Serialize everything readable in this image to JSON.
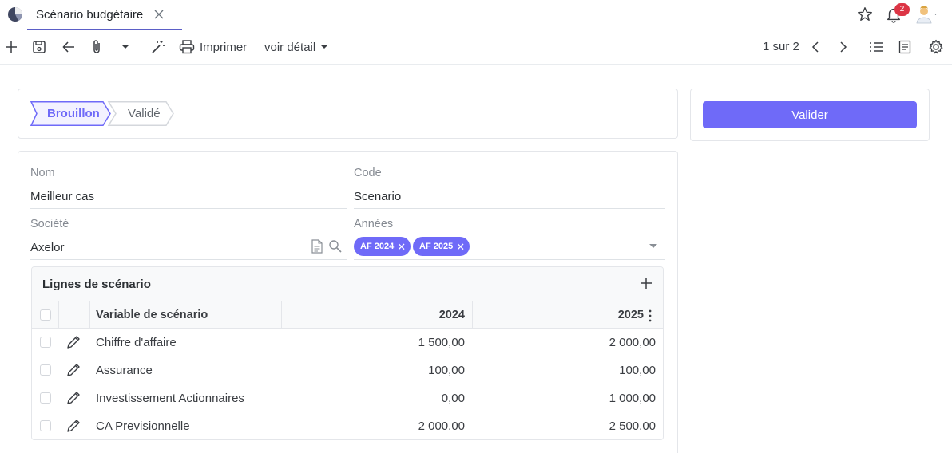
{
  "tabbar": {
    "tab_title": "Scénario budgétaire",
    "notification_count": "2"
  },
  "toolbar": {
    "print_label": "Imprimer",
    "detail_label": "voir détail",
    "pager_text": "1 sur 2"
  },
  "status": {
    "steps": [
      "Brouillon",
      "Validé"
    ],
    "active_step": "Brouillon"
  },
  "side": {
    "validate_label": "Valider"
  },
  "form": {
    "name_label": "Nom",
    "name_value": "Meilleur cas",
    "code_label": "Code",
    "code_value": "Scenario",
    "company_label": "Société",
    "company_value": "Axelor",
    "years_label": "Années",
    "years": [
      "AF 2024",
      "AF 2025"
    ]
  },
  "grid": {
    "title": "Lignes de scénario",
    "columns": [
      "Variable de scénario",
      "2024",
      "2025"
    ],
    "rows": [
      {
        "variable": "Chiffre d'affaire",
        "y2024": "1 500,00",
        "y2025": "2 000,00"
      },
      {
        "variable": "Assurance",
        "y2024": "100,00",
        "y2025": "100,00"
      },
      {
        "variable": "Investissement Actionnaires",
        "y2024": "0,00",
        "y2025": "1 000,00"
      },
      {
        "variable": "CA Previsionnelle",
        "y2024": "2 000,00",
        "y2025": "2 500,00"
      }
    ]
  },
  "colors": {
    "accent": "#6f6af8",
    "tab_underline": "#5b5fc7",
    "badge": "#dc3545"
  }
}
